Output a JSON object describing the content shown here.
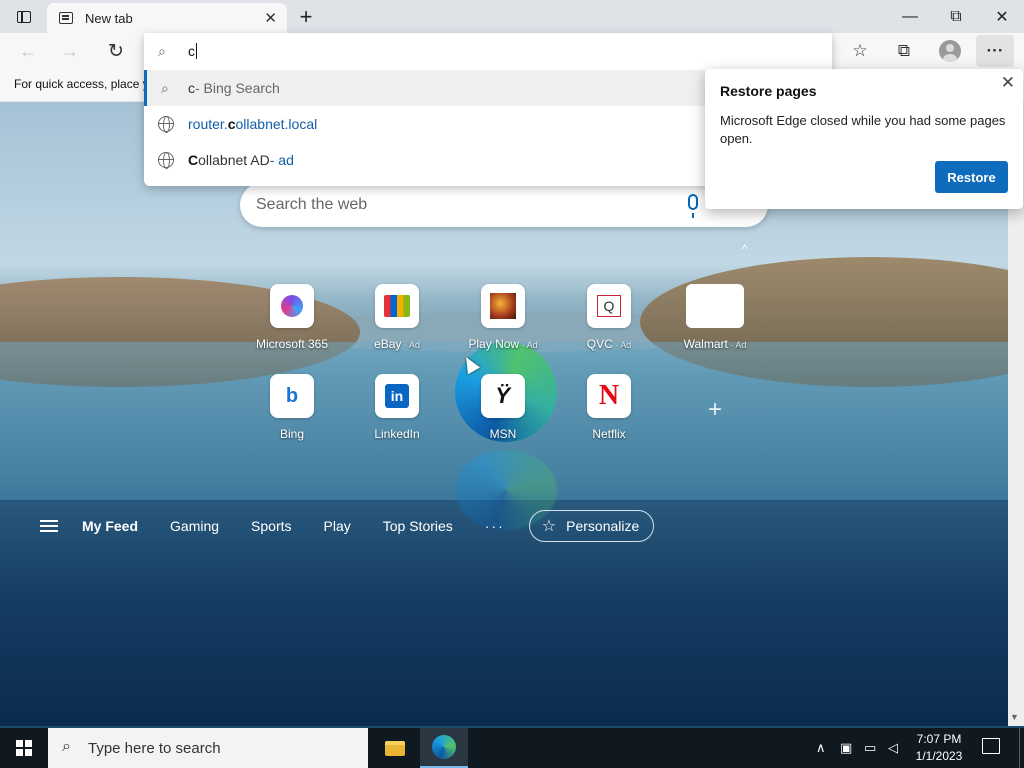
{
  "browser": {
    "tab_title": "New tab",
    "tab_close_icon": "close-icon",
    "new_tab_symbol": "+",
    "window": {
      "minimize": "—",
      "maximize": "⧉",
      "close": "✕"
    }
  },
  "toolbar": {
    "back_icon": "←",
    "forward_icon": "→",
    "refresh_icon": "↻",
    "favorites_icon": "☆",
    "collections_icon": "⧉",
    "menu_icon": "···"
  },
  "address_bar": {
    "value": "c",
    "search_icon": "⌕",
    "suggestions": [
      {
        "query": "c",
        "rest": " - Bing Search"
      },
      {
        "pre": "router.",
        "bold": "c",
        "post": "ollabnet.local"
      },
      {
        "bold": "C",
        "post": "ollabnet AD",
        "ad": " - ad"
      }
    ]
  },
  "favorites_bar": {
    "text": "For quick access, place y"
  },
  "restore_popup": {
    "title": "Restore pages",
    "message": "Microsoft Edge closed while you had some pages open.",
    "button": "Restore",
    "close_icon": "✕"
  },
  "new_tab_page": {
    "search_placeholder": "Search the web",
    "collapse_icon": "^",
    "quick_links": [
      {
        "label": "Microsoft 365",
        "ad": ""
      },
      {
        "label": "eBay",
        "ad": " · Ad"
      },
      {
        "label": "Play Now",
        "ad": " · Ad"
      },
      {
        "label": "QVC",
        "ad": " · Ad"
      },
      {
        "label": "Walmart",
        "ad": " · Ad"
      },
      {
        "label": "Bing",
        "ad": ""
      },
      {
        "label": "LinkedIn",
        "ad": ""
      },
      {
        "label": "MSN",
        "ad": ""
      },
      {
        "label": "Netflix",
        "ad": ""
      }
    ],
    "tile_glyphs": {
      "qvc": "Q",
      "bing": "b",
      "linkedin": "in",
      "msn": "Ÿ",
      "netflix": "N"
    },
    "add_symbol": "+",
    "feed_nav": {
      "items": [
        "My Feed",
        "Gaming",
        "Sports",
        "Play",
        "Top Stories"
      ],
      "more": "···",
      "personalize": "Personalize",
      "personalize_icon": "☆"
    }
  },
  "taskbar": {
    "search_placeholder": "Type here to search",
    "search_icon": "⌕",
    "tray": {
      "chevron": "∧",
      "meet": "▣",
      "network": "▭",
      "volume": "◁"
    },
    "time": "7:07 PM",
    "date": "1/1/2023"
  },
  "scrollbar": {
    "down_arrow": "▼"
  }
}
